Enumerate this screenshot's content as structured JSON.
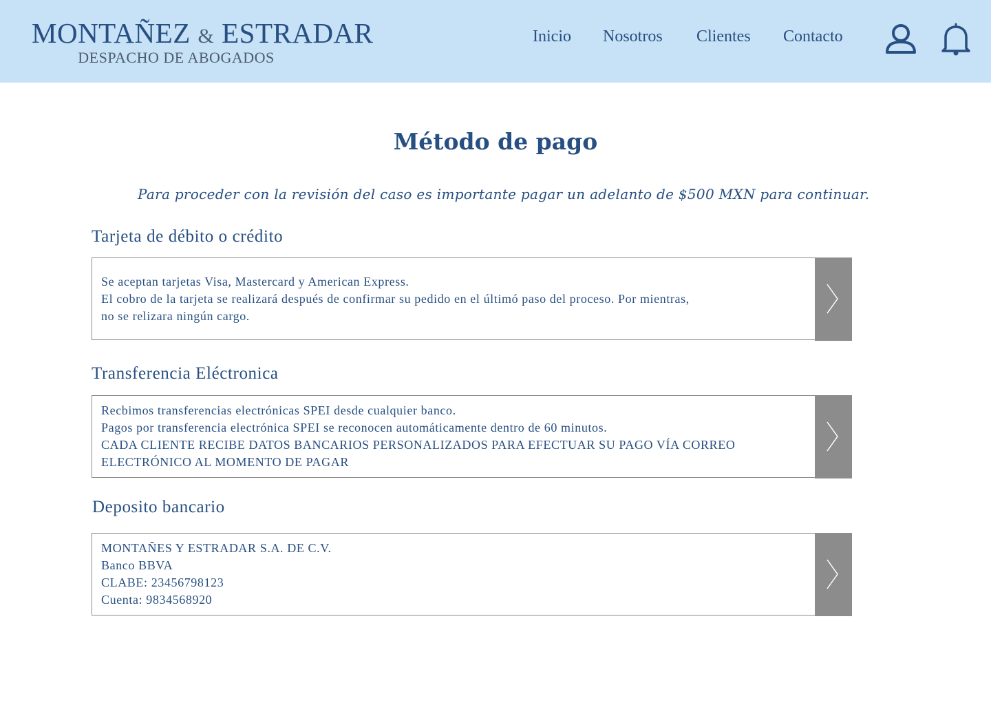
{
  "brand": {
    "name_part1": "MONTAÑEZ",
    "ampersand": "&",
    "name_part2": "ESTRADAR",
    "subtitle": "DESPACHO DE ABOGADOS"
  },
  "nav": {
    "items": [
      {
        "label": "Inicio"
      },
      {
        "label": "Nosotros"
      },
      {
        "label": "Clientes"
      },
      {
        "label": "Contacto"
      }
    ],
    "icons": [
      "user-icon",
      "bell-icon"
    ]
  },
  "page": {
    "title": "Método de pago",
    "intro": "Para proceder con la revisión del caso es importante pagar un adelanto de $500 MXN para continuar."
  },
  "sections": [
    {
      "title": "Tarjeta de débito o crédito",
      "lines": [
        "Se aceptan tarjetas Visa, Mastercard y American Express.",
        "El cobro de la tarjeta se realizará después de confirmar su pedido en el últimó paso del proceso. Por mientras,",
        "no se relizara ningún cargo."
      ]
    },
    {
      "title": "Transferencia Eléctronica",
      "lines": [
        "Recbimos transferencias electrónicas SPEI desde cualquier banco.",
        "Pagos por transferencia electrónica SPEI se reconocen automáticamente dentro de 60 minutos.",
        "CADA CLIENTE RECIBE DATOS BANCARIOS PERSONALIZADOS PARA EFECTUAR SU PAGO VÍA CORREO",
        "ELECTRÓNICO AL MOMENTO DE PAGAR"
      ]
    },
    {
      "title": "Deposito bancario",
      "lines": [
        "MONTAÑES Y ESTRADAR S.A. DE C.V.",
        "Banco BBVA",
        "CLABE: 23456798123",
        "Cuenta: 9834568920"
      ]
    }
  ],
  "colors": {
    "header_bg": "#c7e1f6",
    "primary": "#274f82",
    "arrow_bg": "#8c8c8c"
  }
}
